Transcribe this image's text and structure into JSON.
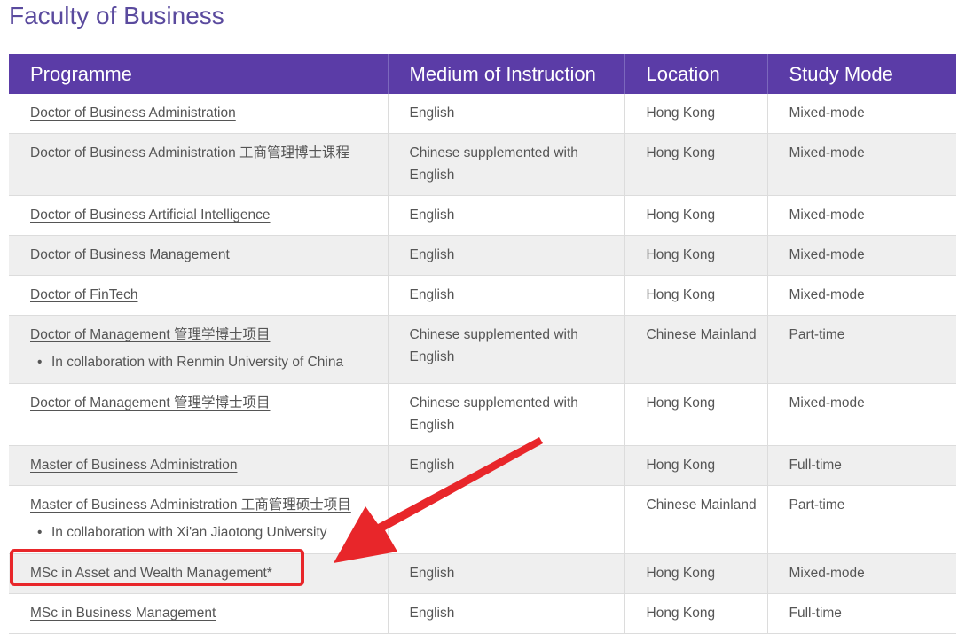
{
  "page": {
    "title": "Faculty of Business"
  },
  "table": {
    "headers": [
      "Programme",
      "Medium of Instruction",
      "Location",
      "Study Mode"
    ],
    "rows": [
      {
        "programme": "Doctor of Business Administration",
        "link": true,
        "note": "",
        "medium": "English",
        "location": "Hong Kong",
        "mode": "Mixed-mode"
      },
      {
        "programme": "Doctor of Business Administration 工商管理博士课程",
        "link": true,
        "note": "",
        "medium": "Chinese supplemented with English",
        "location": "Hong Kong",
        "mode": "Mixed-mode"
      },
      {
        "programme": "Doctor of Business Artificial Intelligence",
        "link": true,
        "note": "",
        "medium": "English",
        "location": "Hong Kong",
        "mode": "Mixed-mode"
      },
      {
        "programme": "Doctor of Business Management",
        "link": true,
        "note": "",
        "medium": "English",
        "location": "Hong Kong",
        "mode": "Mixed-mode"
      },
      {
        "programme": "Doctor of FinTech",
        "link": true,
        "note": "",
        "medium": "English",
        "location": "Hong Kong",
        "mode": "Mixed-mode"
      },
      {
        "programme": "Doctor of Management 管理学博士项目",
        "link": true,
        "note": "In collaboration with Renmin University of China",
        "medium": "Chinese supplemented with English",
        "location": "Chinese Mainland",
        "mode": "Part-time"
      },
      {
        "programme": "Doctor of Management 管理学博士项目",
        "link": true,
        "note": "",
        "medium": "Chinese supplemented with English",
        "location": "Hong Kong",
        "mode": "Mixed-mode"
      },
      {
        "programme": "Master of Business Administration",
        "link": true,
        "note": "",
        "medium": "English",
        "location": "Hong Kong",
        "mode": "Full-time"
      },
      {
        "programme": "Master of Business Administration 工商管理硕士项目",
        "link": true,
        "note": "In collaboration with Xi'an Jiaotong University",
        "medium": "",
        "location": "Chinese Mainland",
        "mode": "Part-time"
      },
      {
        "programme": "MSc in Asset and Wealth Management*",
        "link": false,
        "note": "",
        "medium": "English",
        "location": "Hong Kong",
        "mode": "Mixed-mode"
      },
      {
        "programme": "MSc in Business Management",
        "link": true,
        "note": "",
        "medium": "English",
        "location": "Hong Kong",
        "mode": "Full-time"
      }
    ]
  },
  "annotation": {
    "highlighted_row": "MSc in Asset and Wealth Management*",
    "color": "#e8262a"
  },
  "colors": {
    "header_bg": "#5b3ca7",
    "title": "#5a4a9e",
    "stripe": "#efefef"
  }
}
